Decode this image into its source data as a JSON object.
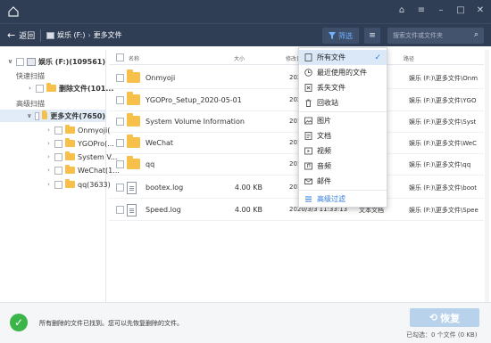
{
  "toolbar": {
    "back_label": "返回",
    "drive_label": "娱乐 (F:)",
    "crumb_sep": "›",
    "folder_label": "更多文件",
    "filter_label": "筛选",
    "search_placeholder": "搜索文件或文件夹"
  },
  "tree": {
    "root": "娱乐 (F:)(109561)",
    "quick_scan": "快速扫描",
    "deleted": "删除文件(101...",
    "advanced_scan": "高级扫描",
    "more_files": "更多文件(7650)",
    "children": [
      "Onmyoji(...",
      "YGOPro(...",
      "System V...",
      "WeChat(1...",
      "qq(3633)"
    ]
  },
  "list": {
    "headers": {
      "name": "名称",
      "size": "大小",
      "date": "修改日",
      "type": "类型",
      "path": "路径"
    },
    "rows": [
      {
        "name": "Onmyoji",
        "size": "",
        "date": "202",
        "type": "",
        "path": "娱乐 (F:)\\更多文件\\Onm",
        "kind": "folder"
      },
      {
        "name": "YGOPro_Setup_2020-05-01",
        "size": "",
        "date": "202",
        "type": "",
        "path": "娱乐 (F:)\\更多文件\\YGO",
        "kind": "folder"
      },
      {
        "name": "System Volume Information",
        "size": "",
        "date": "201",
        "type": "",
        "path": "娱乐 (F:)\\更多文件\\Syst",
        "kind": "folder"
      },
      {
        "name": "WeChat",
        "size": "",
        "date": "201",
        "type": "",
        "path": "娱乐 (F:)\\更多文件\\WeC",
        "kind": "folder"
      },
      {
        "name": "qq",
        "size": "",
        "date": "201",
        "type": "",
        "path": "娱乐 (F:)\\更多文件\\qq",
        "kind": "folder"
      },
      {
        "name": "bootex.log",
        "size": "4.00 KB",
        "date": "201",
        "type": "",
        "path": "娱乐 (F:)\\更多文件\\boot",
        "kind": "file"
      },
      {
        "name": "Speed.log",
        "size": "4.00 KB",
        "date": "2020/3/3 11:33:13",
        "type": "文本文档",
        "path": "娱乐 (F:)\\更多文件\\Spee",
        "kind": "file"
      }
    ]
  },
  "dropdown": {
    "items": [
      {
        "label": "所有文件",
        "icon": "all-files-icon",
        "active": true
      },
      {
        "label": "最近使用的文件",
        "icon": "recent-icon"
      },
      {
        "label": "丢失文件",
        "icon": "lost-file-icon"
      },
      {
        "label": "回收站",
        "icon": "recycle-bin-icon"
      },
      {
        "label": "图片",
        "icon": "image-icon"
      },
      {
        "label": "文档",
        "icon": "document-icon"
      },
      {
        "label": "视频",
        "icon": "video-icon"
      },
      {
        "label": "音频",
        "icon": "audio-icon"
      },
      {
        "label": "邮件",
        "icon": "mail-icon"
      },
      {
        "label": "高级过滤",
        "icon": "advanced-filter-icon"
      }
    ],
    "check": "✓"
  },
  "bottom": {
    "message": "所有删除的文件已找到。您可以先恢复删除的文件。",
    "recover_label": "恢复",
    "selected_text": "已勾选：0 个文件 (0 KB)"
  },
  "colors": {
    "titlebar": "#2f3d55",
    "accent": "#2f7ad9",
    "folder": "#f7c04a",
    "success": "#3bb54a"
  }
}
